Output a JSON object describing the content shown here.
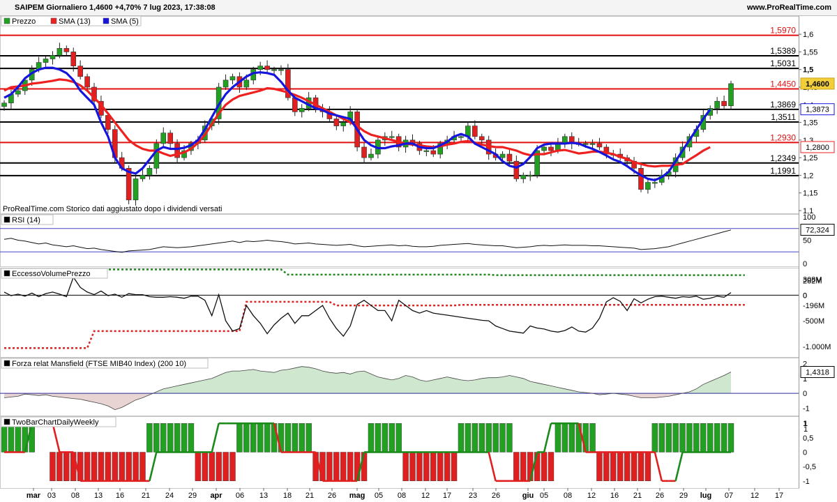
{
  "header": {
    "title": "SAIPEM Giornaliero 1,4600 +4,70% 7 lug 2023, 17:38:08",
    "site": "www.ProRealTime.com"
  },
  "colors": {
    "up": "#22a022",
    "down": "#e02020",
    "sma13": "#ee2020",
    "sma5": "#1515dd",
    "level_red": "#e01010",
    "level_black": "#000000",
    "fill_pos": "#cfe6cf",
    "fill_neg": "#e9d4d4"
  },
  "chart_data": [
    {
      "type": "candlestick",
      "title": "Prezzo",
      "legend": [
        "Prezzo",
        "SMA (13)",
        "SMA (5)"
      ],
      "note": "ProRealTime.com Storico dati aggiustato dopo i dividendi versati",
      "ylim": [
        1.1,
        1.62
      ],
      "y_ticks": [
        "1,6",
        "1,55",
        "1,5",
        "1,45",
        "1,4",
        "1,35",
        "1,3",
        "1,25",
        "1,2",
        "1,15",
        "1,1"
      ],
      "levels": [
        {
          "label": "1,5970",
          "value": 1.597,
          "color": "red"
        },
        {
          "label": "1,5389",
          "value": 1.5389,
          "color": "black"
        },
        {
          "label": "1,5031",
          "value": 1.5031,
          "color": "black"
        },
        {
          "label": "1,4450",
          "value": 1.445,
          "color": "red"
        },
        {
          "label": "1,3869",
          "value": 1.3869,
          "color": "black"
        },
        {
          "label": "1,3511",
          "value": 1.3511,
          "color": "black"
        },
        {
          "label": "1,2930",
          "value": 1.293,
          "color": "red"
        },
        {
          "label": "1,2349",
          "value": 1.2349,
          "color": "black"
        },
        {
          "label": "1,1991",
          "value": 1.1991,
          "color": "black"
        }
      ],
      "badges": [
        {
          "label": "1,4600",
          "value": 1.46,
          "style": "last"
        },
        {
          "label": "1,3873",
          "value": 1.3873,
          "style": "sma5"
        },
        {
          "label": "1,2800",
          "value": 1.28,
          "style": "sma13"
        }
      ],
      "close": [
        1.405,
        1.43,
        1.44,
        1.47,
        1.5,
        1.52,
        1.53,
        1.54,
        1.56,
        1.55,
        1.51,
        1.48,
        1.45,
        1.41,
        1.37,
        1.33,
        1.25,
        1.22,
        1.13,
        1.19,
        1.2,
        1.22,
        1.29,
        1.32,
        1.29,
        1.25,
        1.27,
        1.29,
        1.3,
        1.34,
        1.36,
        1.45,
        1.47,
        1.48,
        1.45,
        1.47,
        1.5,
        1.51,
        1.5,
        1.5,
        1.5,
        1.42,
        1.38,
        1.39,
        1.42,
        1.39,
        1.38,
        1.36,
        1.34,
        1.35,
        1.38,
        1.28,
        1.25,
        1.26,
        1.3,
        1.31,
        1.31,
        1.28,
        1.3,
        1.29,
        1.27,
        1.27,
        1.26,
        1.29,
        1.3,
        1.31,
        1.31,
        1.34,
        1.31,
        1.3,
        1.26,
        1.25,
        1.26,
        1.24,
        1.19,
        1.2,
        1.2,
        1.27,
        1.28,
        1.27,
        1.29,
        1.31,
        1.29,
        1.29,
        1.29,
        1.29,
        1.28,
        1.26,
        1.26,
        1.25,
        1.24,
        1.22,
        1.16,
        1.18,
        1.18,
        1.2,
        1.21,
        1.25,
        1.28,
        1.31,
        1.33,
        1.37,
        1.39,
        1.41,
        1.397,
        1.46
      ],
      "sma13": [
        1.44,
        1.45,
        1.452,
        1.455,
        1.46,
        1.462,
        1.465,
        1.468,
        1.472,
        1.47,
        1.465,
        1.455,
        1.44,
        1.42,
        1.4,
        1.375,
        1.35,
        1.325,
        1.3,
        1.285,
        1.275,
        1.27,
        1.27,
        1.262,
        1.255,
        1.26,
        1.265,
        1.275,
        1.292,
        1.315,
        1.345,
        1.375,
        1.4,
        1.415,
        1.425,
        1.43,
        1.435,
        1.44,
        1.447,
        1.445,
        1.44,
        1.435,
        1.428,
        1.42,
        1.41,
        1.4,
        1.39,
        1.38,
        1.37,
        1.36,
        1.35,
        1.34,
        1.325,
        1.315,
        1.31,
        1.305,
        1.3,
        1.295,
        1.29,
        1.287,
        1.285,
        1.282,
        1.28,
        1.282,
        1.287,
        1.29,
        1.295,
        1.297,
        1.293,
        1.287,
        1.283,
        1.28,
        1.28,
        1.275,
        1.27,
        1.262,
        1.257,
        1.26,
        1.26,
        1.265,
        1.27,
        1.272,
        1.267,
        1.262,
        1.264,
        1.267,
        1.267,
        1.264,
        1.26,
        1.252,
        1.247,
        1.237,
        1.232,
        1.227,
        1.225,
        1.227,
        1.227,
        1.23,
        1.232,
        1.245,
        1.257,
        1.27,
        1.28
      ],
      "sma5": [
        1.42,
        1.43,
        1.45,
        1.475,
        1.49,
        1.5,
        1.505,
        1.505,
        1.5,
        1.49,
        1.47,
        1.44,
        1.42,
        1.4,
        1.35,
        1.31,
        1.25,
        1.22,
        1.21,
        1.205,
        1.22,
        1.245,
        1.27,
        1.28,
        1.275,
        1.275,
        1.278,
        1.285,
        1.3,
        1.33,
        1.365,
        1.4,
        1.43,
        1.45,
        1.465,
        1.48,
        1.49,
        1.492,
        1.49,
        1.485,
        1.465,
        1.44,
        1.42,
        1.41,
        1.4,
        1.39,
        1.385,
        1.375,
        1.37,
        1.365,
        1.36,
        1.33,
        1.3,
        1.285,
        1.277,
        1.277,
        1.282,
        1.285,
        1.29,
        1.29,
        1.28,
        1.277,
        1.277,
        1.285,
        1.295,
        1.31,
        1.317,
        1.31,
        1.29,
        1.28,
        1.27,
        1.26,
        1.24,
        1.227,
        1.222,
        1.232,
        1.252,
        1.277,
        1.287,
        1.29,
        1.29,
        1.29,
        1.292,
        1.29,
        1.282,
        1.275,
        1.266,
        1.256,
        1.245,
        1.238,
        1.226,
        1.212,
        1.2,
        1.19,
        1.186,
        1.195,
        1.21,
        1.24,
        1.27,
        1.3,
        1.33,
        1.36,
        1.387
      ]
    },
    {
      "type": "line",
      "title": "RSI (14)",
      "ylim": [
        0,
        100
      ],
      "y_ticks": [
        "100",
        "50",
        "0"
      ],
      "bands": [
        75,
        25
      ],
      "last_label": "72,324",
      "values": [
        52,
        54,
        50,
        48,
        45,
        42,
        44,
        40,
        38,
        36,
        38,
        35,
        32,
        33,
        30,
        28,
        26,
        24,
        27,
        28,
        29,
        30,
        33,
        36,
        35,
        34,
        35,
        36,
        38,
        40,
        42,
        44,
        46,
        48,
        45,
        48,
        47,
        48,
        50,
        48,
        47,
        45,
        42,
        43,
        44,
        42,
        41,
        40,
        39,
        40,
        41,
        38,
        36,
        37,
        38,
        39,
        40,
        38,
        39,
        37,
        36,
        36,
        37,
        39,
        40,
        41,
        42,
        43,
        41,
        40,
        39,
        38,
        38,
        36,
        34,
        35,
        36,
        38,
        39,
        38,
        39,
        40,
        39,
        39,
        39,
        38,
        38,
        37,
        36,
        35,
        34,
        33,
        30,
        31,
        32,
        34,
        36,
        40,
        44,
        48,
        52,
        56,
        60,
        64,
        68,
        72
      ]
    },
    {
      "type": "line",
      "title": "EccessoVolumePrezzo",
      "ylim": [
        -1150,
        480
      ],
      "y_ticks": [
        "0",
        "-500M",
        "-1.000M"
      ],
      "labels": [
        {
          "label": "308M",
          "value": 308,
          "color": "green"
        },
        {
          "label": "282M",
          "value": 282,
          "color": "black"
        },
        {
          "label": "0",
          "value": 0,
          "color": "black"
        },
        {
          "label": "-196M",
          "value": -196,
          "color": "red"
        }
      ],
      "main": [
        60,
        -10,
        20,
        -20,
        40,
        -30,
        30,
        60,
        20,
        -30,
        350,
        150,
        60,
        10,
        80,
        -10,
        20,
        -40,
        30,
        10,
        10,
        -30,
        -40,
        -40,
        -30,
        -40,
        -60,
        -20,
        -20,
        -100,
        -400,
        10,
        -500,
        -700,
        -650,
        -200,
        -400,
        -550,
        -750,
        -580,
        -450,
        -350,
        -550,
        -400,
        -400,
        -300,
        -200,
        -450,
        -650,
        -800,
        -600,
        -180,
        -100,
        -200,
        -300,
        -300,
        -500,
        -100,
        -200,
        -300,
        -350,
        -300,
        -350,
        -370,
        -390,
        -410,
        -430,
        -450,
        -470,
        -490,
        -500,
        -600,
        -650,
        -700,
        -720,
        -740,
        -600,
        -640,
        -660,
        -700,
        -720,
        -690,
        -620,
        -700,
        -720,
        -640,
        -450,
        -130,
        -50,
        -120,
        -300,
        -70,
        -150,
        -80,
        -30,
        -20,
        -40,
        -60,
        -30,
        -40,
        -20,
        -80,
        -60,
        -20,
        -40,
        50,
        -70,
        10,
        20,
        -30,
        0
      ],
      "upper": [
        500,
        500,
        500,
        500,
        500,
        500,
        500,
        500,
        500,
        500,
        500,
        500,
        500,
        500,
        500,
        500,
        500,
        500,
        500,
        500,
        500,
        500,
        500,
        500,
        500,
        500,
        500,
        500,
        500,
        500,
        500,
        500,
        500,
        500,
        500,
        500,
        500,
        500,
        500,
        500,
        500,
        500,
        500,
        500,
        500,
        500,
        500,
        500,
        500,
        500,
        500,
        500,
        500,
        500,
        500,
        500,
        500,
        500,
        500,
        500,
        500,
        500,
        500,
        500,
        500,
        500,
        500,
        500,
        500,
        500,
        500,
        500,
        500,
        500,
        500,
        500,
        500,
        500,
        500,
        500,
        500,
        500,
        500,
        500,
        500,
        500,
        500,
        500,
        500,
        500,
        500,
        500,
        500,
        500,
        500,
        500,
        500,
        500,
        500,
        500,
        500,
        500,
        500,
        500,
        500,
        500,
        500,
        500
      ],
      "lower": [
        -1030,
        -1030,
        -1030,
        -1030,
        -1030,
        -1030,
        -1030,
        -1030,
        -1030,
        -1030,
        -1030,
        -1030,
        -1030,
        -1030,
        -1030,
        -1030,
        -1030,
        -1030,
        -1030,
        -1030,
        -1030,
        -1030,
        -1030,
        -1030,
        -1030,
        -1030,
        -1030,
        -1030,
        -1030,
        -1030,
        -1030,
        -1030,
        -1030,
        -1030,
        -1030,
        -1030,
        -1030,
        -1030,
        -1030,
        -1030,
        -1030,
        -1030,
        -1030,
        -1030,
        -1030,
        -1030,
        -1030,
        -1030,
        -1030,
        -1030,
        -1030,
        -1030,
        -1030,
        -1030,
        -1030,
        -1030,
        -1030,
        -1030,
        -1030,
        -1030,
        -1030,
        -1030,
        -1030,
        -1030,
        -1030,
        -1030,
        -1030,
        -1030,
        -1030,
        -1030,
        -1030,
        -1030,
        -1030,
        -1030,
        -1030,
        -1030,
        -1030,
        -1030,
        -1030,
        -1030,
        -1030,
        -1030,
        -1030,
        -1030,
        -1030,
        -1030,
        -1030,
        -1030,
        -1030,
        -1030,
        -1030,
        -1030,
        -1030,
        -1030,
        -1030,
        -1030,
        -1030,
        -1030,
        -1030,
        -1030,
        -1030,
        -1030,
        -1030,
        -1030,
        -1030,
        -1030,
        -1030,
        -1030
      ]
    },
    {
      "type": "area",
      "title": "Forza relat Mansfield (FTSE MIB40 Index) (200 10)",
      "ylim": [
        -1.4,
        2.3
      ],
      "y_ticks": [
        "2",
        "1",
        "0",
        "-1"
      ],
      "last_label": "1,4318",
      "values": [
        -0.3,
        -0.25,
        -0.2,
        -0.05,
        -0.1,
        -0.15,
        -0.1,
        -0.2,
        -0.25,
        -0.3,
        -0.35,
        -0.4,
        -0.5,
        -0.6,
        -0.7,
        -0.85,
        -1.1,
        -0.95,
        -0.7,
        -0.45,
        -0.3,
        -0.1,
        0.1,
        0.3,
        0.4,
        0.5,
        0.6,
        0.7,
        0.8,
        0.9,
        1.0,
        1.2,
        1.4,
        1.5,
        1.5,
        1.55,
        1.6,
        1.5,
        1.45,
        1.4,
        1.55,
        1.6,
        1.7,
        1.8,
        1.75,
        1.65,
        1.5,
        1.4,
        1.35,
        1.4,
        1.3,
        1.45,
        1.5,
        1.3,
        1.1,
        1.0,
        0.9,
        1.0,
        1.2,
        1.1,
        0.9,
        0.8,
        0.9,
        1.0,
        1.1,
        1.0,
        0.9,
        0.85,
        0.9,
        1.0,
        1.05,
        1.05,
        1.1,
        1.2,
        1.1,
        1.0,
        0.8,
        0.7,
        0.6,
        0.5,
        0.4,
        0.3,
        0.2,
        0.1,
        0.05,
        0.0,
        -0.1,
        -0.05,
        0.0,
        -0.05,
        -0.1,
        -0.2,
        -0.3,
        -0.3,
        -0.3,
        -0.25,
        -0.2,
        -0.1,
        0.0,
        0.1,
        0.3,
        0.6,
        0.8,
        1.0,
        1.2,
        1.4318
      ]
    },
    {
      "type": "bar",
      "title": "TwoBarChartDailyWeekly",
      "ylim": [
        -1.15,
        1.15
      ],
      "y_ticks": [
        "1",
        "0,5",
        "0",
        "-0,5",
        "-1"
      ],
      "last_labels": [
        "1",
        "1"
      ],
      "daily": [
        1,
        1,
        1,
        1,
        1,
        0,
        0,
        -1,
        -1,
        -1,
        -1,
        -1,
        -1,
        -1,
        -1,
        -1,
        -1,
        -1,
        -1,
        -1,
        -1,
        1,
        1,
        1,
        1,
        1,
        1,
        1,
        -1,
        -1,
        -1,
        -1,
        -1,
        -1,
        1,
        1,
        1,
        1,
        1,
        1,
        1,
        1,
        1,
        1,
        1,
        -1,
        -1,
        -1,
        -1,
        -1,
        -1,
        -1,
        -1,
        1,
        1,
        1,
        1,
        1,
        -1,
        -1,
        -1,
        -1,
        -1,
        -1,
        -1,
        -1,
        1,
        1,
        1,
        1,
        1,
        1,
        1,
        1,
        -1,
        -1,
        -1,
        -1,
        -1,
        -1,
        1,
        1,
        1,
        1,
        1,
        1,
        -1,
        -1,
        -1,
        -1,
        -1,
        -1,
        -1,
        -1,
        1,
        1,
        1,
        1,
        1,
        1,
        1,
        1,
        1,
        1,
        1,
        1,
        1,
        1,
        1,
        1,
        1,
        1
      ],
      "weekly": [
        0,
        0,
        0,
        0,
        1,
        1,
        1,
        1,
        0,
        0,
        0,
        -1,
        -1,
        -1,
        -1,
        -1,
        -1,
        -1,
        -1,
        -1,
        -1,
        -1,
        0,
        0,
        0,
        0,
        0,
        0,
        0,
        0,
        0,
        1,
        1,
        1,
        1,
        1,
        1,
        1,
        1,
        1,
        0,
        0,
        0,
        0,
        0,
        0,
        -1,
        -1,
        -1,
        -1,
        -1,
        -1,
        0,
        0,
        0,
        0,
        0,
        0,
        0,
        0,
        0,
        0,
        0,
        0,
        0,
        0,
        0,
        0,
        0,
        0,
        0,
        -1,
        -1,
        -1,
        -1,
        -1,
        -1,
        0,
        0,
        1,
        1,
        1,
        1,
        1,
        0,
        0,
        0,
        0,
        0,
        0,
        0,
        0,
        0,
        0,
        0,
        -1,
        -1,
        -1,
        0,
        0,
        0,
        0,
        0,
        0,
        0,
        0,
        1,
        1,
        1,
        1
      ]
    }
  ],
  "x_axis": {
    "labels": [
      "mar",
      "03",
      "08",
      "13",
      "16",
      "21",
      "24",
      "29",
      "apr",
      "06",
      "13",
      "18",
      "21",
      "26",
      "mag",
      "05",
      "08",
      "12",
      "17",
      "23",
      "26",
      "giu",
      "05",
      "08",
      "12",
      "16",
      "21",
      "26",
      "29",
      "lug",
      "07",
      "12",
      "17"
    ],
    "bold": [
      "mar",
      "apr",
      "mag",
      "giu",
      "lug"
    ]
  }
}
